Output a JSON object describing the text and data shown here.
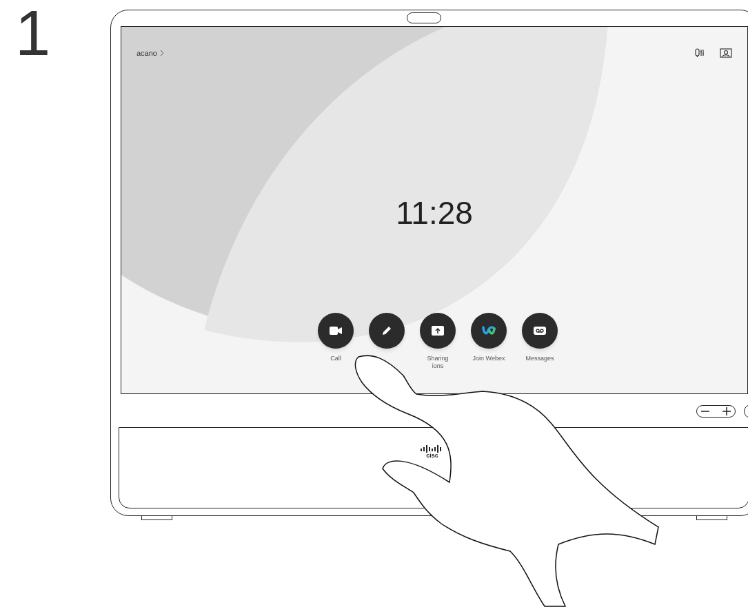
{
  "step": "1",
  "screen": {
    "room": "acano",
    "status_icons": [
      {
        "kind": "mic"
      },
      {
        "kind": "selfview"
      }
    ],
    "clock": "11:28",
    "actions": [
      {
        "kind": "camera",
        "label_lines": [
          "Call"
        ]
      },
      {
        "kind": "pen"
      },
      {
        "kind": "share",
        "label_lines": [
          "Sharing",
          "ions"
        ]
      },
      {
        "kind": "webex",
        "label_lines": [
          "Join Webex"
        ]
      },
      {
        "kind": "voicemail",
        "label_lines": [
          "Messages"
        ]
      }
    ]
  },
  "logo_text": "cisc"
}
